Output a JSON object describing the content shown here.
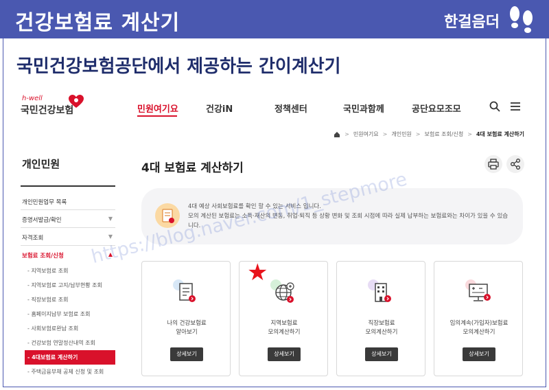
{
  "slide": {
    "title": "건강보험료 계산기",
    "brand": "한걸음더",
    "subtitle": "국민건강보험공단에서 제공하는 간이계산기"
  },
  "site": {
    "logo": {
      "tagline": "h-well",
      "name": "국민건강보험"
    },
    "nav": [
      {
        "label": "민원여기요",
        "active": true
      },
      {
        "label": "건강iN",
        "active": false
      },
      {
        "label": "정책센터",
        "active": false
      },
      {
        "label": "국민과함께",
        "active": false
      },
      {
        "label": "공단요모조모",
        "active": false
      }
    ],
    "icons": {
      "search": "search-icon",
      "menu": "hamburger-menu-icon",
      "home": "home-icon",
      "print": "print-icon",
      "share": "share-icon"
    },
    "breadcrumb": [
      "민원여기요",
      "개인민원",
      "보험료 조회/신청",
      "4대 보험료 계산하기"
    ]
  },
  "sidebar": {
    "title": "개인민원",
    "items": [
      {
        "label": "개인민원업무 목록",
        "caret": ""
      },
      {
        "label": "증명서발급/확인",
        "caret": "▼"
      },
      {
        "label": "자격조회",
        "caret": "▼"
      },
      {
        "label": "보험료 조회/신청",
        "caret": "▲"
      }
    ],
    "sub_items": [
      {
        "label": "지역보험료 조회",
        "active": false
      },
      {
        "label": "지역보험료 고지/납부현황 조회",
        "active": false
      },
      {
        "label": "직장보험료 조회",
        "active": false
      },
      {
        "label": "홈페이지납부 보험료 조회",
        "active": false
      },
      {
        "label": "사회보험료완납 조회",
        "active": false
      },
      {
        "label": "건강보험 연말정산내역 조회",
        "active": false
      },
      {
        "label": "4대보험료 계산하기",
        "active": true
      },
      {
        "label": "주택금융부채 공제 신청 및 조회",
        "active": false
      }
    ]
  },
  "main": {
    "title": "4대 보험료 계산하기",
    "notice": [
      "4대 예상 사회보험료를 확인 할 수 있는 서비스 입니다.",
      "모의 계산된 보험료는 소득·재산의 변동, 취업·퇴직 등 상황 변화 및 조회 시점에 따라 실제 납부하는 보험료와는 차이가 있을 수 있습니다."
    ],
    "cards": [
      {
        "line1": "나의 건강보험료",
        "line2": "알아보기",
        "button": "상세보기",
        "icon": "document-icon"
      },
      {
        "line1": "지역보험료",
        "line2": "모의계산하기",
        "button": "상세보기",
        "icon": "globe-icon"
      },
      {
        "line1": "직장보험료",
        "line2": "모의계산하기",
        "button": "상세보기",
        "icon": "building-icon"
      },
      {
        "line1": "임의계속(가입자)보험료",
        "line2": "모의계산하기",
        "button": "상세보기",
        "icon": "calculator-monitor-icon"
      }
    ],
    "highlight": "★"
  },
  "watermark": "https://blog.naver.com/1_stepmore",
  "colors": {
    "header": "#4a58b0",
    "accent": "#d9112b",
    "star": "#e8131b",
    "button": "#3a3a3a"
  }
}
